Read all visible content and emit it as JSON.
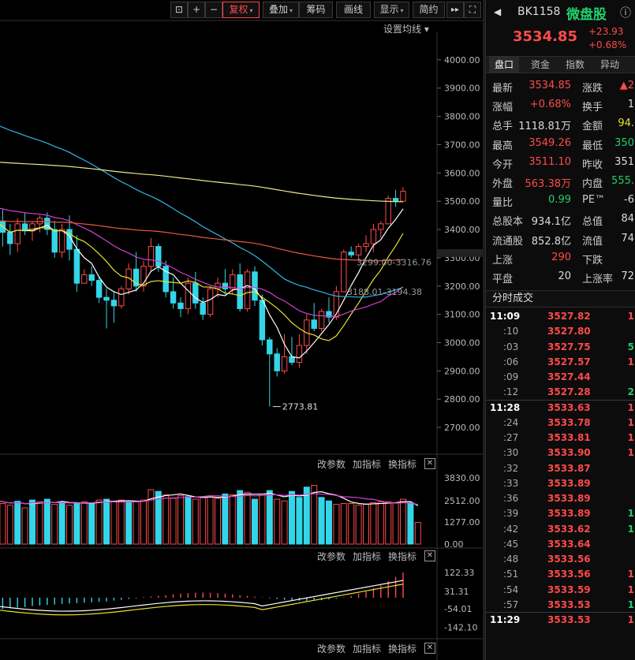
{
  "toolbar": {
    "buttons": [
      {
        "key": "lock",
        "label": "⊡"
      },
      {
        "key": "zoom_in",
        "label": "+"
      },
      {
        "key": "zoom_out",
        "label": "−"
      },
      {
        "key": "fuquan",
        "label": "复权",
        "caret": "▾",
        "active": true
      },
      {
        "key": "overlay",
        "label": "叠加",
        "caret": "▾"
      },
      {
        "key": "chips",
        "label": "筹码"
      },
      {
        "key": "draw",
        "label": "画线"
      },
      {
        "key": "display",
        "label": "显示",
        "caret": "▾"
      },
      {
        "key": "simple",
        "label": "简约"
      },
      {
        "key": "forward",
        "label": "▸▸"
      },
      {
        "key": "fullscreen",
        "label": "⛶"
      }
    ],
    "ma_setting": "设置均线 ▾"
  },
  "panel_controls": {
    "change_params": "改参数",
    "add_indicator": "加指标",
    "switch_indicator": "换指标",
    "close": "✕"
  },
  "colors": {
    "up": "#ff4a4a",
    "down": "#33d6e8",
    "ma5": "#ffffff",
    "ma10": "#e6e12e",
    "ma20": "#d23fd2",
    "ma60": "#33b5e5",
    "ma120": "#e85c3c",
    "ma250": "#f0e68c"
  },
  "chart_data": [
    {
      "type": "candlestick",
      "name": "main",
      "ylim": [
        2650,
        4100
      ],
      "yticks": [
        "4000.00",
        "3900.00",
        "3800.00",
        "3700.00",
        "3600.00",
        "3500.00",
        "3400.00",
        "3300.00",
        "3200.00",
        "3100.00",
        "3000.00",
        "2900.00",
        "2800.00",
        "2700.00"
      ],
      "yticks_values": [
        4000,
        3900,
        3800,
        3700,
        3600,
        3500,
        3400,
        3300,
        3200,
        3100,
        3000,
        2900,
        2800,
        2700
      ],
      "candles": [
        [
          3520,
          3550,
          3400,
          3430
        ],
        [
          3430,
          3470,
          3340,
          3390
        ],
        [
          3390,
          3420,
          3310,
          3350
        ],
        [
          3350,
          3440,
          3320,
          3420
        ],
        [
          3420,
          3460,
          3380,
          3395
        ],
        [
          3395,
          3430,
          3360,
          3420
        ],
        [
          3420,
          3450,
          3390,
          3440
        ],
        [
          3440,
          3460,
          3380,
          3400
        ],
        [
          3400,
          3430,
          3300,
          3320
        ],
        [
          3320,
          3420,
          3300,
          3400
        ],
        [
          3400,
          3450,
          3290,
          3330
        ],
        [
          3330,
          3380,
          3180,
          3210
        ],
        [
          3210,
          3260,
          3230,
          3240
        ],
        [
          3240,
          3270,
          3200,
          3220
        ],
        [
          3220,
          3230,
          3140,
          3160
        ],
        [
          3160,
          3190,
          3050,
          3150
        ],
        [
          3150,
          3180,
          3070,
          3130
        ],
        [
          3130,
          3200,
          3120,
          3190
        ],
        [
          3190,
          3280,
          3170,
          3260
        ],
        [
          3260,
          3320,
          3180,
          3200
        ],
        [
          3200,
          3290,
          3180,
          3270
        ],
        [
          3270,
          3370,
          3250,
          3340
        ],
        [
          3340,
          3350,
          3250,
          3270
        ],
        [
          3270,
          3290,
          3160,
          3180
        ],
        [
          3180,
          3230,
          3120,
          3140
        ],
        [
          3140,
          3160,
          3090,
          3120
        ],
        [
          3120,
          3230,
          3100,
          3210
        ],
        [
          3210,
          3250,
          3120,
          3140
        ],
        [
          3140,
          3160,
          3080,
          3100
        ],
        [
          3100,
          3200,
          3090,
          3190
        ],
        [
          3190,
          3230,
          3160,
          3210
        ],
        [
          3210,
          3260,
          3170,
          3190
        ],
        [
          3190,
          3260,
          3170,
          3240
        ],
        [
          3240,
          3280,
          3110,
          3120
        ],
        [
          3120,
          3260,
          3110,
          3250
        ],
        [
          3250,
          3270,
          3130,
          3150
        ],
        [
          3150,
          3170,
          2990,
          3010
        ],
        [
          3010,
          3020,
          2773.81,
          2960
        ],
        [
          2960,
          2980,
          2880,
          2900
        ],
        [
          2900,
          3030,
          2890,
          2950
        ],
        [
          2950,
          3020,
          2920,
          2930
        ],
        [
          2930,
          3030,
          2910,
          2990
        ],
        [
          2990,
          3100,
          2960,
          3080
        ],
        [
          3080,
          3140,
          3040,
          3050
        ],
        [
          3050,
          3120,
          3040,
          3110
        ],
        [
          3110,
          3160,
          3070,
          3090
        ],
        [
          3090,
          3200,
          3080,
          3180
        ],
        [
          3180,
          3330,
          3180,
          3320
        ],
        [
          3320,
          3340,
          3300,
          3310
        ],
        [
          3310,
          3350,
          3290,
          3340
        ],
        [
          3340,
          3380,
          3320,
          3350
        ],
        [
          3350,
          3420,
          3320,
          3400
        ],
        [
          3400,
          3430,
          3370,
          3420
        ],
        [
          3420,
          3520,
          3420,
          3510
        ],
        [
          3510,
          3540,
          3480,
          3500
        ],
        [
          3500,
          3549.26,
          3511.1,
          3534.85
        ]
      ],
      "low_annotation": "2773.81",
      "ma60_label": "3299.00-3316.76",
      "ma20_label": "3188.01-3194.38",
      "last_price_marker": "3316.76"
    },
    {
      "type": "bar",
      "name": "volume",
      "ylim": [
        0,
        4200
      ],
      "yticks": [
        "3830.00",
        "2512.00",
        "1277.00",
        "0.00"
      ],
      "yticks_values": [
        3830,
        2512,
        1277,
        0
      ],
      "values": [
        2550,
        2350,
        2250,
        2480,
        2100,
        2550,
        2450,
        2600,
        2300,
        2450,
        2250,
        2400,
        2450,
        2350,
        2550,
        2600,
        2450,
        2550,
        2400,
        2450,
        2550,
        3150,
        3050,
        2850,
        2650,
        2800,
        2750,
        2600,
        2700,
        2800,
        2650,
        2900,
        2850,
        3100,
        3000,
        2600,
        2900,
        3100,
        2600,
        2500,
        3050,
        2700,
        3300,
        3400,
        2700,
        2500,
        2300,
        2350,
        2350,
        2250,
        2300,
        2400,
        2450,
        2450,
        2400,
        2600,
        2400,
        1250
      ],
      "up": [
        0,
        1,
        1,
        0,
        1,
        0,
        1,
        0,
        1,
        0,
        1,
        0,
        1,
        0,
        1,
        0,
        1,
        1,
        0,
        1,
        1,
        1,
        0,
        1,
        1,
        1,
        0,
        1,
        1,
        1,
        1,
        0,
        1,
        0,
        1,
        0,
        1,
        0,
        1,
        1,
        0,
        0,
        0,
        1,
        0,
        0,
        1,
        1,
        1,
        1,
        1,
        1,
        1,
        1,
        1,
        1,
        0,
        1
      ]
    },
    {
      "type": "bar",
      "name": "macd",
      "ylim": [
        -160,
        160
      ],
      "yticks": [
        "122.33",
        "31.31",
        "-54.01",
        "-142.10"
      ],
      "yticks_values": [
        122.33,
        31.31,
        -54.01,
        -142.1
      ],
      "values": [
        -60,
        -55,
        -50,
        -48,
        -45,
        -40,
        -38,
        -35,
        -33,
        -30,
        -28,
        -26,
        -24,
        -22,
        -20,
        -18,
        -14,
        -10,
        -6,
        -3,
        3,
        6,
        9,
        12,
        16,
        20,
        22,
        24,
        25,
        24,
        22,
        20,
        16,
        12,
        9,
        5,
        2,
        -3,
        -6,
        -10,
        -12,
        -14,
        -16,
        -15,
        -12,
        -8,
        -4,
        2,
        8,
        20,
        30,
        45,
        60,
        80,
        100,
        122.33
      ]
    }
  ],
  "quote": {
    "code": "BK1158",
    "name": "微盘股",
    "info_icon": "ⓘ",
    "price": "3534.85",
    "change": "+23.93",
    "change_pct": "+0.68%"
  },
  "tabs": [
    {
      "label": "盘口",
      "active": true
    },
    {
      "label": "资金"
    },
    {
      "label": "指数"
    },
    {
      "label": "异动"
    }
  ],
  "stats": [
    {
      "l": "最新",
      "v": "3534.85",
      "vc": "red",
      "l2": "涨跌",
      "v2": "▲2",
      "v2c": "red"
    },
    {
      "l": "涨幅",
      "v": "+0.68%",
      "vc": "red",
      "l2": "换手",
      "v2": "1",
      "v2c": "white"
    },
    {
      "l": "总手",
      "v": "1118.81万",
      "vc": "white",
      "l2": "金额",
      "v2": "94.",
      "v2c": "yellow"
    },
    {
      "l": "最高",
      "v": "3549.26",
      "vc": "red",
      "l2": "最低",
      "v2": "350",
      "v2c": "green"
    },
    {
      "l": "今开",
      "v": "3511.10",
      "vc": "red",
      "l2": "昨收",
      "v2": "351",
      "v2c": "white"
    },
    {
      "l": "外盘",
      "v": "563.38万",
      "vc": "red",
      "l2": "内盘",
      "v2": "555.",
      "v2c": "green"
    },
    {
      "l": "量比",
      "v": "0.99",
      "vc": "green",
      "l2": "PE™",
      "v2": "-6",
      "v2c": "white"
    },
    {
      "l": "总股本",
      "v": "934.1亿",
      "vc": "white",
      "l2": "总值",
      "v2": "84",
      "v2c": "white"
    },
    {
      "l": "流通股",
      "v": "852.8亿",
      "vc": "white",
      "l2": "流值",
      "v2": "74",
      "v2c": "white"
    },
    {
      "l": "上涨",
      "v": "290",
      "vc": "red",
      "l2": "下跌",
      "v2": "",
      "v2c": "white"
    },
    {
      "l": "平盘",
      "v": "20",
      "vc": "white",
      "l2": "上涨率",
      "v2": "72",
      "v2c": "white"
    }
  ],
  "ticks_title": "分时成交",
  "ticks": [
    {
      "t": "11:09",
      "p": "3527.82",
      "v": "1",
      "vc": "red",
      "head": true
    },
    {
      "t": ":10",
      "p": "3527.80",
      "v": "",
      "vc": "red"
    },
    {
      "t": ":03",
      "p": "3527.75",
      "v": "5",
      "vc": "green"
    },
    {
      "t": ":06",
      "p": "3527.57",
      "v": "1",
      "vc": "red"
    },
    {
      "t": ":09",
      "p": "3527.44",
      "v": "",
      "vc": "red"
    },
    {
      "t": ":12",
      "p": "3527.28",
      "v": "2",
      "vc": "green"
    },
    {
      "t": "11:28",
      "p": "3533.63",
      "v": "1",
      "vc": "red",
      "head": true,
      "sep": true
    },
    {
      "t": ":24",
      "p": "3533.78",
      "v": "1",
      "vc": "red"
    },
    {
      "t": ":27",
      "p": "3533.81",
      "v": "1",
      "vc": "red"
    },
    {
      "t": ":30",
      "p": "3533.90",
      "v": "1",
      "vc": "red"
    },
    {
      "t": ":32",
      "p": "3533.87",
      "v": "",
      "vc": "red"
    },
    {
      "t": ":33",
      "p": "3533.89",
      "v": "",
      "vc": "red"
    },
    {
      "t": ":36",
      "p": "3533.89",
      "v": "",
      "vc": "red"
    },
    {
      "t": ":39",
      "p": "3533.89",
      "v": "1",
      "vc": "green"
    },
    {
      "t": ":42",
      "p": "3533.62",
      "v": "1",
      "vc": "green"
    },
    {
      "t": ":45",
      "p": "3533.64",
      "v": "",
      "vc": "red"
    },
    {
      "t": ":48",
      "p": "3533.56",
      "v": "",
      "vc": "red"
    },
    {
      "t": ":51",
      "p": "3533.56",
      "v": "1",
      "vc": "red"
    },
    {
      "t": ":54",
      "p": "3533.59",
      "v": "1",
      "vc": "red"
    },
    {
      "t": ":57",
      "p": "3533.53",
      "v": "1",
      "vc": "green"
    },
    {
      "t": "11:29",
      "p": "3533.53",
      "v": "1",
      "vc": "red",
      "head": true,
      "sep": true
    }
  ]
}
